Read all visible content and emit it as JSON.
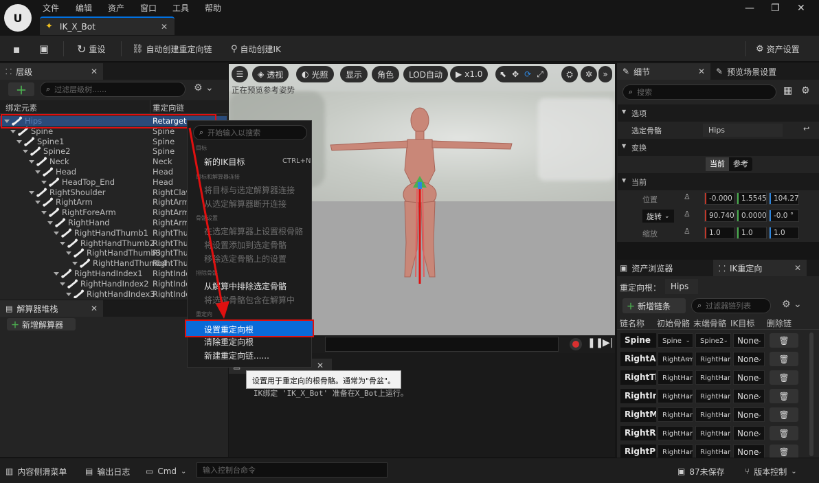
{
  "menu": [
    "文件",
    "编辑",
    "资产",
    "窗口",
    "工具",
    "帮助"
  ],
  "document_tab": "IK_X_Bot",
  "toolbar": {
    "reset": "重设",
    "auto_chains": "自动创建重定向链",
    "auto_ik": "自动创建IK",
    "asset_settings": "资产设置"
  },
  "hierarchy": {
    "tab": "层级",
    "search_placeholder": "过滤层级树......",
    "col_element": "绑定元素",
    "col_chain": "重定向链",
    "rows": [
      {
        "name": "Hips",
        "chain": "Retarget"
      },
      {
        "name": "Spine",
        "chain": "Spine"
      },
      {
        "name": "Spine1",
        "chain": "Spine"
      },
      {
        "name": "Spine2",
        "chain": "Spine"
      },
      {
        "name": "Neck",
        "chain": "Neck"
      },
      {
        "name": "Head",
        "chain": "Head"
      },
      {
        "name": "HeadTop_End",
        "chain": "Head"
      },
      {
        "name": "RightShoulder",
        "chain": "RightClav"
      },
      {
        "name": "RightArm",
        "chain": "RightArm"
      },
      {
        "name": "RightForeArm",
        "chain": "RightArm"
      },
      {
        "name": "RightHand",
        "chain": "RightArm"
      },
      {
        "name": "RightHandThumb1",
        "chain": "RightThu"
      },
      {
        "name": "RightHandThumb2",
        "chain": "RightThu"
      },
      {
        "name": "RightHandThumb3",
        "chain": "RightThu"
      },
      {
        "name": "RightHandThumb4",
        "chain": "RightThu"
      },
      {
        "name": "RightHandIndex1",
        "chain": "RightInde"
      },
      {
        "name": "RightHandIndex2",
        "chain": "RightInde"
      },
      {
        "name": "RightHandIndex3",
        "chain": "RightInde"
      }
    ]
  },
  "solver": {
    "tab": "解算器堆栈",
    "add": "新增解算器"
  },
  "viewport": {
    "perspective": "透视",
    "lit": "光照",
    "show": "显示",
    "character": "角色",
    "lod": "LOD自动",
    "play_speed": "x1.0",
    "overlay": "正在预览参考姿势"
  },
  "context_menu": {
    "search_placeholder": "开始输入以搜索",
    "sec_goal": "目标",
    "new_ik_goal": "新的IK目标",
    "new_ik_goal_shortcut": "CTRL+N",
    "sec_connect": "目标和解算器连接",
    "connect": "将目标与选定解算器连接",
    "disconnect": "从选定解算器断开连接",
    "sec_bone": "骨骼设置",
    "set_root": "在选定解算器上设置根骨骼",
    "add_settings": "将设置添加到选定骨骼",
    "remove_settings": "移除选定骨骼上的设置",
    "sec_exclude": "排除骨骼",
    "exclude": "从解算中排除选定骨骼",
    "include": "将选定骨骼包含在解算中",
    "sec_retarget": "重定向",
    "set_retarget_root": "设置重定向根",
    "clear_retarget_root": "清除重定向根",
    "new_chain": "新建重定向链......"
  },
  "tooltip": "设置用于重定向的根骨骼。通常为\"骨盆\"。",
  "log_text": "IK绑定 'IK_X_Bot' 准备在X_Bot上运行。",
  "details": {
    "tab": "细节",
    "tab2": "预览场景设置",
    "search_placeholder": "搜索",
    "sec_selection": "选项",
    "selected_bone_label": "选定骨骼",
    "selected_bone_value": "Hips",
    "sec_transform": "变换",
    "toggle_current": "当前",
    "toggle_reference": "参考",
    "sec_current": "当前",
    "location_label": "位置",
    "location": [
      "-0.000",
      "1.5545",
      "104.27"
    ],
    "rotation_label": "旋转",
    "rotation": [
      "90.740",
      "0.0000",
      "-0.0 °"
    ],
    "scale_label": "缩放",
    "scale": [
      "1.0",
      "1.0",
      "1.0"
    ]
  },
  "ik_retarget": {
    "tab_assets": "资产浏览器",
    "tab": "IK重定向",
    "root_label": "重定向根：",
    "root_value": "Hips",
    "add_chain": "新增链条",
    "search_placeholder": "过滤器链列表",
    "cols": [
      "链名称",
      "初始骨骼",
      "末端骨骼",
      "IK目标",
      "删除链"
    ],
    "rows": [
      {
        "name": "Spine",
        "start": "Spine",
        "end": "Spine2",
        "ik": "None"
      },
      {
        "name": "RightArm",
        "start": "RightArm",
        "end": "RightHand",
        "ik": "None"
      },
      {
        "name": "RightThumb",
        "start": "RightHand",
        "end": "RightHand",
        "ik": "None"
      },
      {
        "name": "RightIndex",
        "start": "RightHand",
        "end": "RightHand",
        "ik": "None"
      },
      {
        "name": "RightMiddle",
        "start": "RightHand",
        "end": "RightHand",
        "ik": "None"
      },
      {
        "name": "RightRing",
        "start": "RightHand",
        "end": "RightHand",
        "ik": "None"
      },
      {
        "name": "RightPinky",
        "start": "RightHand",
        "end": "RightHand",
        "ik": "None"
      }
    ]
  },
  "statusbar": {
    "content_drawer": "内容侧滑菜单",
    "output_log": "输出日志",
    "cmd": "Cmd",
    "console_placeholder": "输入控制台命令",
    "unsaved": "87未保存",
    "source_control": "版本控制"
  },
  "colors": {
    "accent": "#0070e0",
    "selection_highlight": "#e01010",
    "x_axis": "#c0392b",
    "y_axis": "#4caf50",
    "z_axis": "#2e86de"
  }
}
